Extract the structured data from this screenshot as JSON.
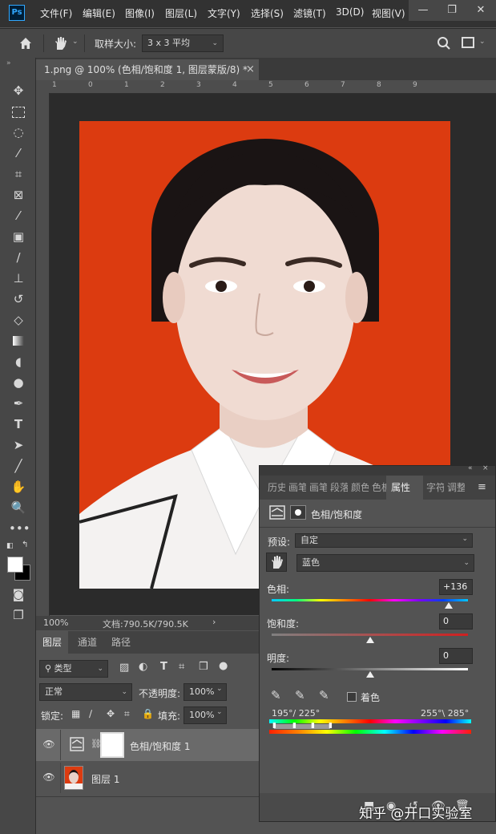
{
  "app": {
    "logo": "Ps"
  },
  "menu": [
    "文件(F)",
    "编辑(E)",
    "图像(I)",
    "图层(L)",
    "文字(Y)",
    "选择(S)",
    "滤镜(T)",
    "3D(D)",
    "视图(V)"
  ],
  "window_controls": {
    "minimize": "—",
    "restore": "❐",
    "close": "✕"
  },
  "options_bar": {
    "sample_label": "取样大小:",
    "sample_value": "3 x 3 平均"
  },
  "document": {
    "tab_title": "1.png @ 100% (色相/饱和度 1, 图层蒙版/8) *",
    "close": "×"
  },
  "ruler": {
    "ticks": [
      "1",
      "0",
      "1",
      "2",
      "3",
      "4",
      "5",
      "6",
      "7",
      "8",
      "9"
    ]
  },
  "status": {
    "zoom": "100%",
    "doc_info": "文档:790.5K/790.5K",
    "arrow": "›"
  },
  "layers_panel": {
    "tabs": [
      "图层",
      "通道",
      "路径"
    ],
    "filter_label": "类型",
    "blend_mode": "正常",
    "opacity_label": "不透明度:",
    "opacity_value": "100%",
    "lock_label": "锁定:",
    "fill_label": "填充:",
    "fill_value": "100%",
    "layers": [
      {
        "name": "色相/饱和度 1",
        "selected": true
      },
      {
        "name": "图层 1",
        "selected": false
      }
    ]
  },
  "properties_panel": {
    "tabs": [
      "历史",
      "画笔",
      "画笔",
      "段落",
      "颜色",
      "色板",
      "属性",
      "字符",
      "调整"
    ],
    "title": "色相/饱和度",
    "preset_label": "预设:",
    "preset_value": "自定",
    "channel_value": "蓝色",
    "hue_label": "色相:",
    "hue_value": "+136",
    "hue_level": 0.9,
    "saturation_label": "饱和度:",
    "saturation_value": "0",
    "saturation_level": 0.5,
    "lightness_label": "明度:",
    "lightness_value": "0",
    "lightness_level": 0.5,
    "colorize_label": "着色",
    "range_left": "195°/ 225°",
    "range_right": "255°\\ 285°"
  },
  "watermark": "知乎 @开口实验室",
  "colors": {
    "accent": "#dc3b10",
    "panel": "#535353",
    "dark": "#323232"
  }
}
